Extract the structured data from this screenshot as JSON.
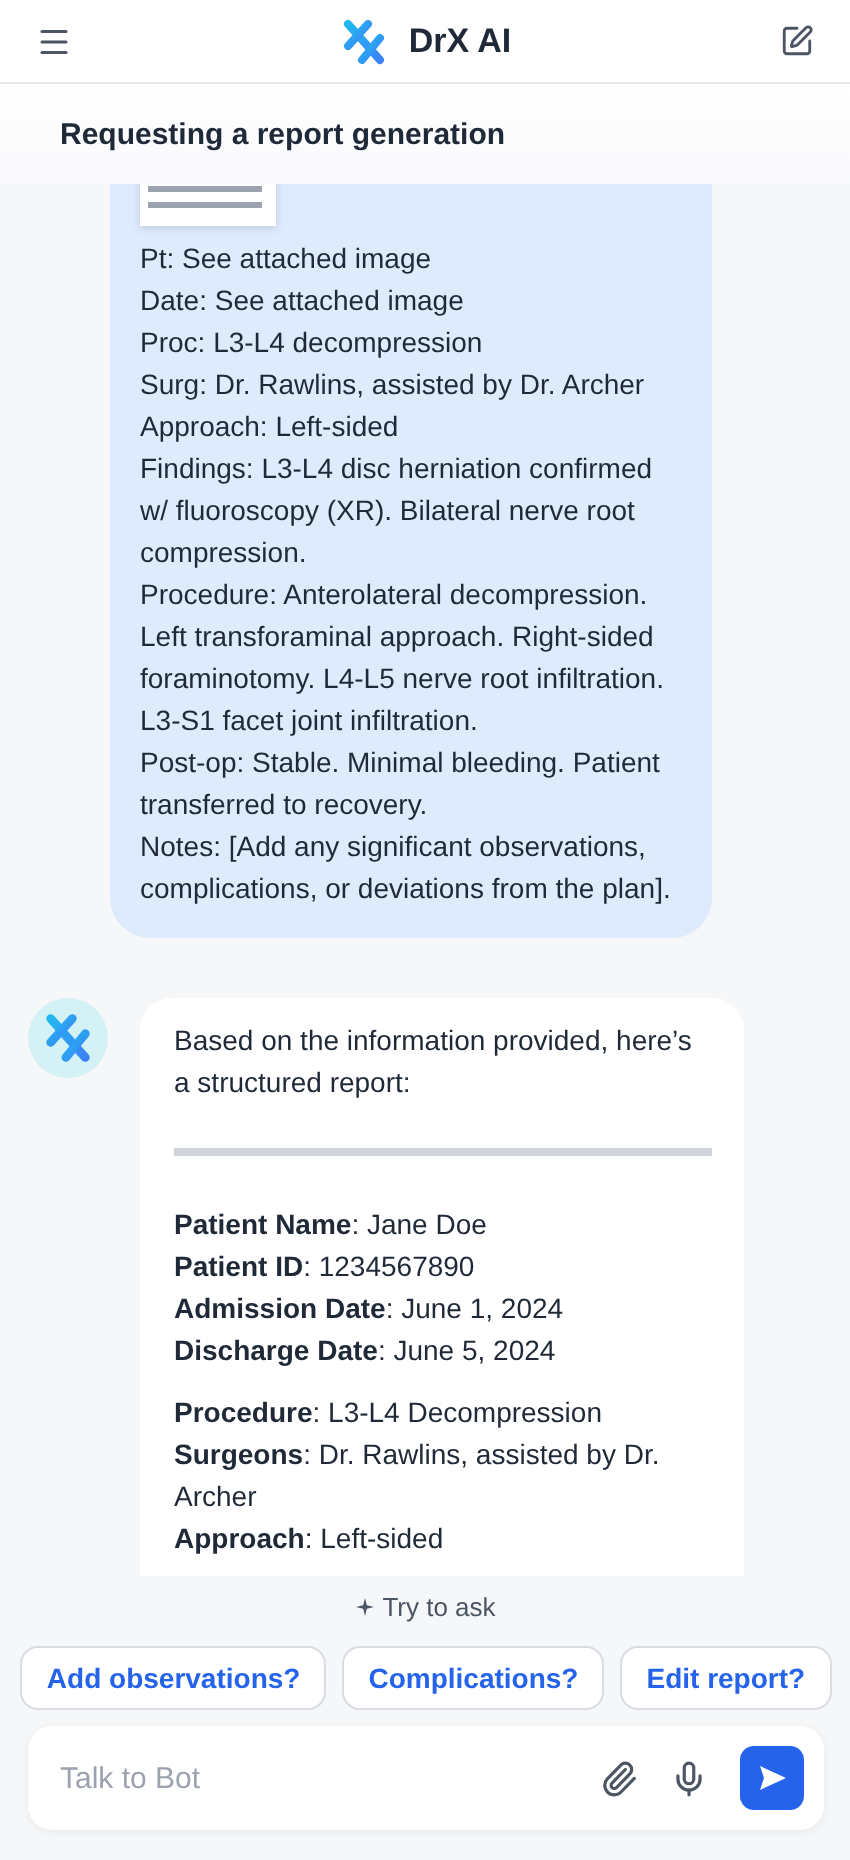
{
  "header": {
    "title": "DrX AI"
  },
  "conversation": {
    "title": "Requesting a report generation"
  },
  "messages": [
    {
      "kind": "user",
      "attachment": true,
      "lines": [
        "Pt: See attached image",
        "Date: See attached image",
        "Proc: L3-L4 decompression",
        "Surg: Dr. Rawlins, assisted by Dr. Archer",
        "Approach: Left-sided",
        "Findings: L3-L4 disc herniation confirmed w/ fluoroscopy (XR). Bilateral nerve root compression.",
        "Procedure: Anterolateral decompression. Left transforaminal approach. Right-sided foraminotomy. L4-L5 nerve root infiltration. L3-S1 facet joint infiltration.",
        "Post-op: Stable. Minimal bleeding. Patient transferred to recovery.",
        "Notes: [Add any significant observations, complications, or deviations from the plan]."
      ]
    },
    {
      "kind": "bot",
      "intro": "Based on the information provided, here’s a structured report:",
      "report_groups": [
        [
          "**Patient Name**: Jane Doe",
          "**Patient ID**: 1234567890",
          "**Admission Date**: June 1, 2024",
          "**Discharge Date**: June 5, 2024"
        ],
        [
          "**Procedure**: L3-L4 Decompression",
          "**Surgeons**: Dr. Rawlins, assisted by Dr. Archer",
          "**Approach**: Left-sided"
        ]
      ]
    }
  ],
  "suggestions": {
    "label": "Try to ask",
    "chips": [
      "Add observations?",
      "Complications?",
      "Edit report?"
    ]
  },
  "composer": {
    "placeholder": "Talk to Bot"
  }
}
